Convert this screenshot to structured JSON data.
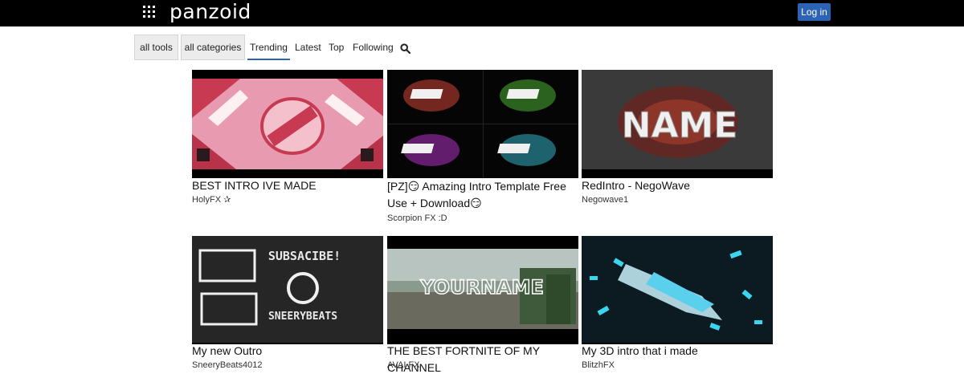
{
  "header": {
    "logo": "panzoid",
    "login_label": "Log in"
  },
  "subnav": {
    "all_tools": "all tools",
    "all_categories": "all categories",
    "tabs": [
      "Trending",
      "Latest",
      "Top",
      "Following"
    ],
    "active_tab": "Trending"
  },
  "cards": [
    {
      "title": "BEST INTRO IVE MADE",
      "author": "HolyFX ✰"
    },
    {
      "title": "[PZ]😏 Amazing Intro Template Free Use + Download😏",
      "author": "Scorpion FX :D"
    },
    {
      "title": "RedIntro - NegoWave",
      "author": "Negowave1"
    },
    {
      "title": "My new Outro",
      "author": "SneeryBeats4012"
    },
    {
      "title": "THE BEST FORTNITE OF MY CHANNEL",
      "author": "AVAI FX"
    },
    {
      "title": "My 3D intro that i made",
      "author": "BlitzhFX"
    }
  ],
  "thumb_text": {
    "card3": "NAME",
    "card4_top": "SUBSACIBE!",
    "card4_bottom": "SNEERYBEATS",
    "card5": "YOURNAME"
  },
  "colors": {
    "topbar": "#000000",
    "accent": "#2c63b5",
    "button_bg": "#ececec"
  },
  "icons": [
    "apps-grid-icon",
    "search-icon"
  ]
}
